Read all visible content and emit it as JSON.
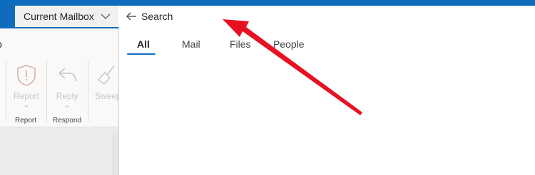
{
  "header": {
    "scope_label": "Current Mailbox",
    "search_placeholder": "Search"
  },
  "ribbon": {
    "truncated_text": "p",
    "buttons": [
      {
        "label": "Report",
        "icon": "shield-warning-icon"
      },
      {
        "label": "Reply",
        "icon": "reply-icon"
      },
      {
        "label": "Sweep",
        "icon": "broom-icon"
      }
    ],
    "groups": [
      "Report",
      "Respond"
    ]
  },
  "search_panel": {
    "tabs": [
      "All",
      "Mail",
      "Files",
      "People"
    ],
    "active_tab": "All"
  },
  "colors": {
    "brand": "#0f6cbd",
    "annotation_arrow": "#e81123"
  }
}
